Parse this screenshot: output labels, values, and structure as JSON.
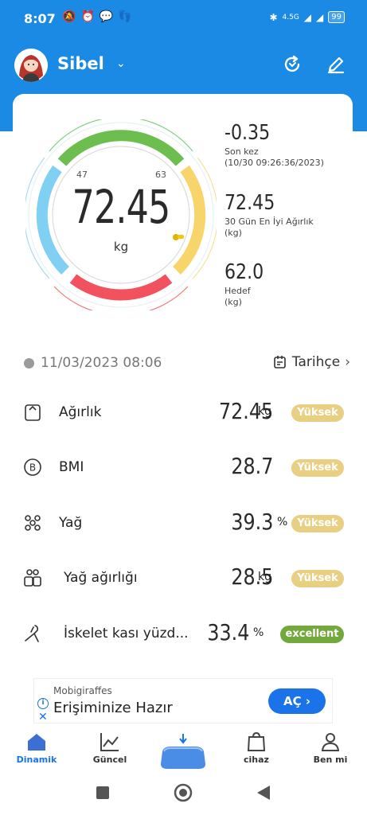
{
  "status_bar": {
    "time": "8:07",
    "network": "4.5G",
    "battery": "99"
  },
  "header": {
    "username": "Sibel"
  },
  "gauge": {
    "value": "72.45",
    "unit": "kg",
    "tick_left": "47",
    "tick_right": "63"
  },
  "stats": [
    {
      "value": "-0.35",
      "label": "Son kez",
      "sub": "(10/30 09:26:36/2023)"
    },
    {
      "value": "72.45",
      "label": "30 Gün En İyi Ağırlık",
      "sub": "(kg)"
    },
    {
      "value": "62.0",
      "label": "Hedef",
      "sub": "(kg)"
    }
  ],
  "date_row": {
    "date": "11/03/2023 08:06",
    "history_label": "Tarihçe"
  },
  "metrics": [
    {
      "label": "Ağırlık",
      "value": "72.45",
      "unit": "kg",
      "badge": "Yüksek"
    },
    {
      "label": "BMI",
      "value": "28.7",
      "unit": "",
      "badge": "Yüksek"
    },
    {
      "label": "Yağ",
      "value": "39.3",
      "unit": "%",
      "badge": "Yüksek"
    },
    {
      "label": "Yağ ağırlığı",
      "value": "28.5",
      "unit": "kg",
      "badge": "Yüksek"
    },
    {
      "label": "İskelet kası yüzd...",
      "value": "33.4",
      "unit": "%",
      "badge": "excellent"
    }
  ],
  "ad": {
    "advertiser": "Mobigiraffes",
    "title": "Erişiminize Hazır",
    "button": "AÇ"
  },
  "nav": [
    {
      "label": "Dinamik"
    },
    {
      "label": "Güncel"
    },
    {
      "label": ""
    },
    {
      "label": "cihaz"
    },
    {
      "label": "Ben mi"
    }
  ],
  "colors": {
    "primary": "#1a8ae5",
    "badge_high": "#e8cf82",
    "badge_excellent": "#73a83c"
  }
}
